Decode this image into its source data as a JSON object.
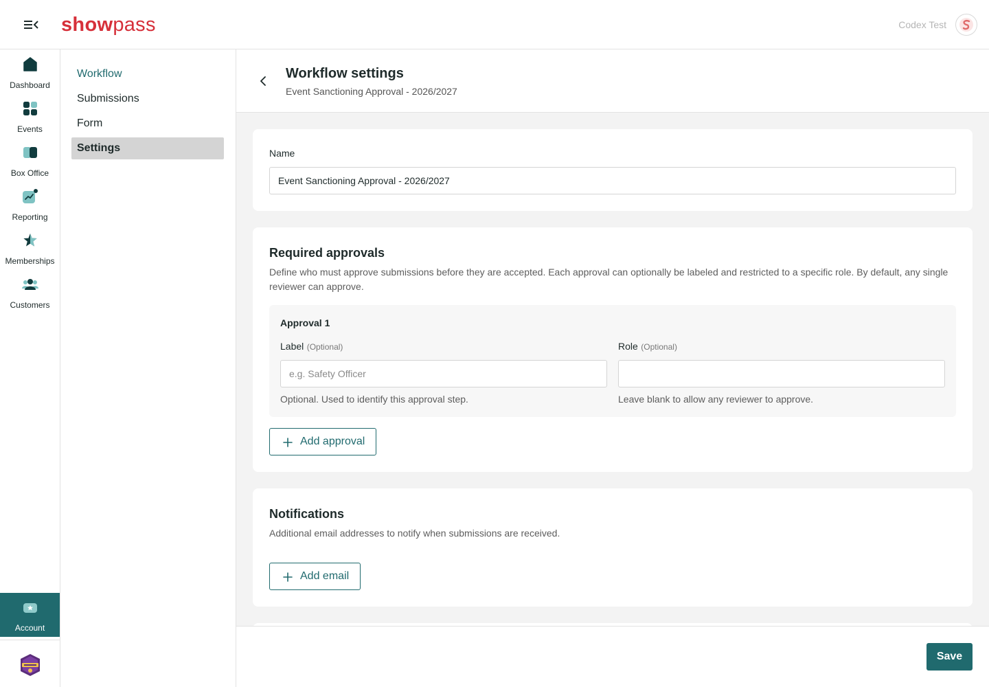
{
  "topbar": {
    "logo_bold": "show",
    "logo_light": "pass",
    "org_name": "Codex Test",
    "icons": {
      "menu": "menu-collapse-icon",
      "avatar": "showpass-logo-icon"
    }
  },
  "leftnav": {
    "items": [
      {
        "label": "Dashboard",
        "icon": "home-icon"
      },
      {
        "label": "Events",
        "icon": "events-grid-icon"
      },
      {
        "label": "Box Office",
        "icon": "box-office-icon"
      },
      {
        "label": "Reporting",
        "icon": "reporting-chart-icon"
      },
      {
        "label": "Memberships",
        "icon": "memberships-star-icon"
      },
      {
        "label": "Customers",
        "icon": "customers-group-icon"
      }
    ],
    "account_label": "Account",
    "accent_color": "#206a6e"
  },
  "subnav": {
    "items": [
      {
        "label": "Workflow"
      },
      {
        "label": "Submissions"
      },
      {
        "label": "Form"
      },
      {
        "label": "Settings"
      }
    ],
    "active": "Settings"
  },
  "page": {
    "title": "Workflow settings",
    "subtitle": "Event Sanctioning Approval - 2026/2027"
  },
  "name_card": {
    "label": "Name",
    "value": "Event Sanctioning Approval - 2026/2027"
  },
  "approvals_card": {
    "title": "Required approvals",
    "description": "Define who must approve submissions before they are accepted. Each approval can optionally be labeled and restricted to a specific role. By default, any single reviewer can approve.",
    "approval_title": "Approval 1",
    "label_field": {
      "label": "Label",
      "optional": "(Optional)",
      "placeholder": "e.g. Safety Officer",
      "hint": "Optional. Used to identify this approval step."
    },
    "role_field": {
      "label": "Role",
      "optional": "(Optional)",
      "value": "",
      "hint": "Leave blank to allow any reviewer to approve."
    },
    "add_button": "Add approval"
  },
  "notifications_card": {
    "title": "Notifications",
    "description": "Additional email addresses to notify when submissions are received.",
    "add_button": "Add email"
  },
  "footer": {
    "save_label": "Save"
  }
}
